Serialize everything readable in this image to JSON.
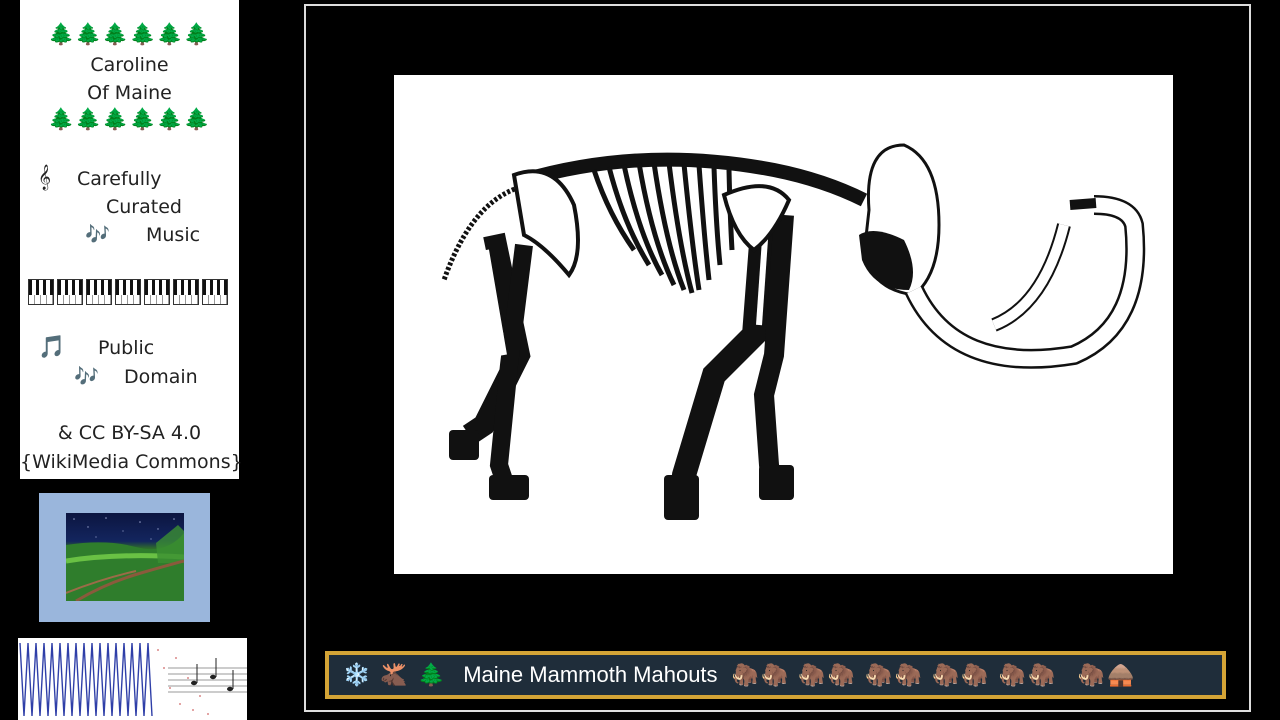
{
  "sidebar": {
    "tree_row": "🌲🌲🌲🌲🌲🌲",
    "name_line1": "Caroline",
    "name_line2": "Of Maine",
    "clef_icon": "𝄞",
    "curated_1": "Carefully",
    "curated_2": "Curated",
    "notes_icon": "🎶",
    "curated_3": "Music",
    "note_icon": "🎵",
    "license_1": "Public",
    "license_2": "Domain",
    "license_3": "&  CC BY-SA 4.0",
    "license_4": "{WikiMedia Commons}"
  },
  "banner": {
    "left_icons": [
      "❄️",
      "🫎",
      "🌲"
    ],
    "title": "Maine Mammoth Mahouts",
    "mammoth_icon": "🦣",
    "mammoth_count": 10,
    "right_icons": [
      "🦣",
      "🛖"
    ]
  },
  "colors": {
    "background": "#000000",
    "banner_border": "#d4a436",
    "banner_fill": "#1f2d3a",
    "thumb_frame": "#9ab6dc"
  }
}
